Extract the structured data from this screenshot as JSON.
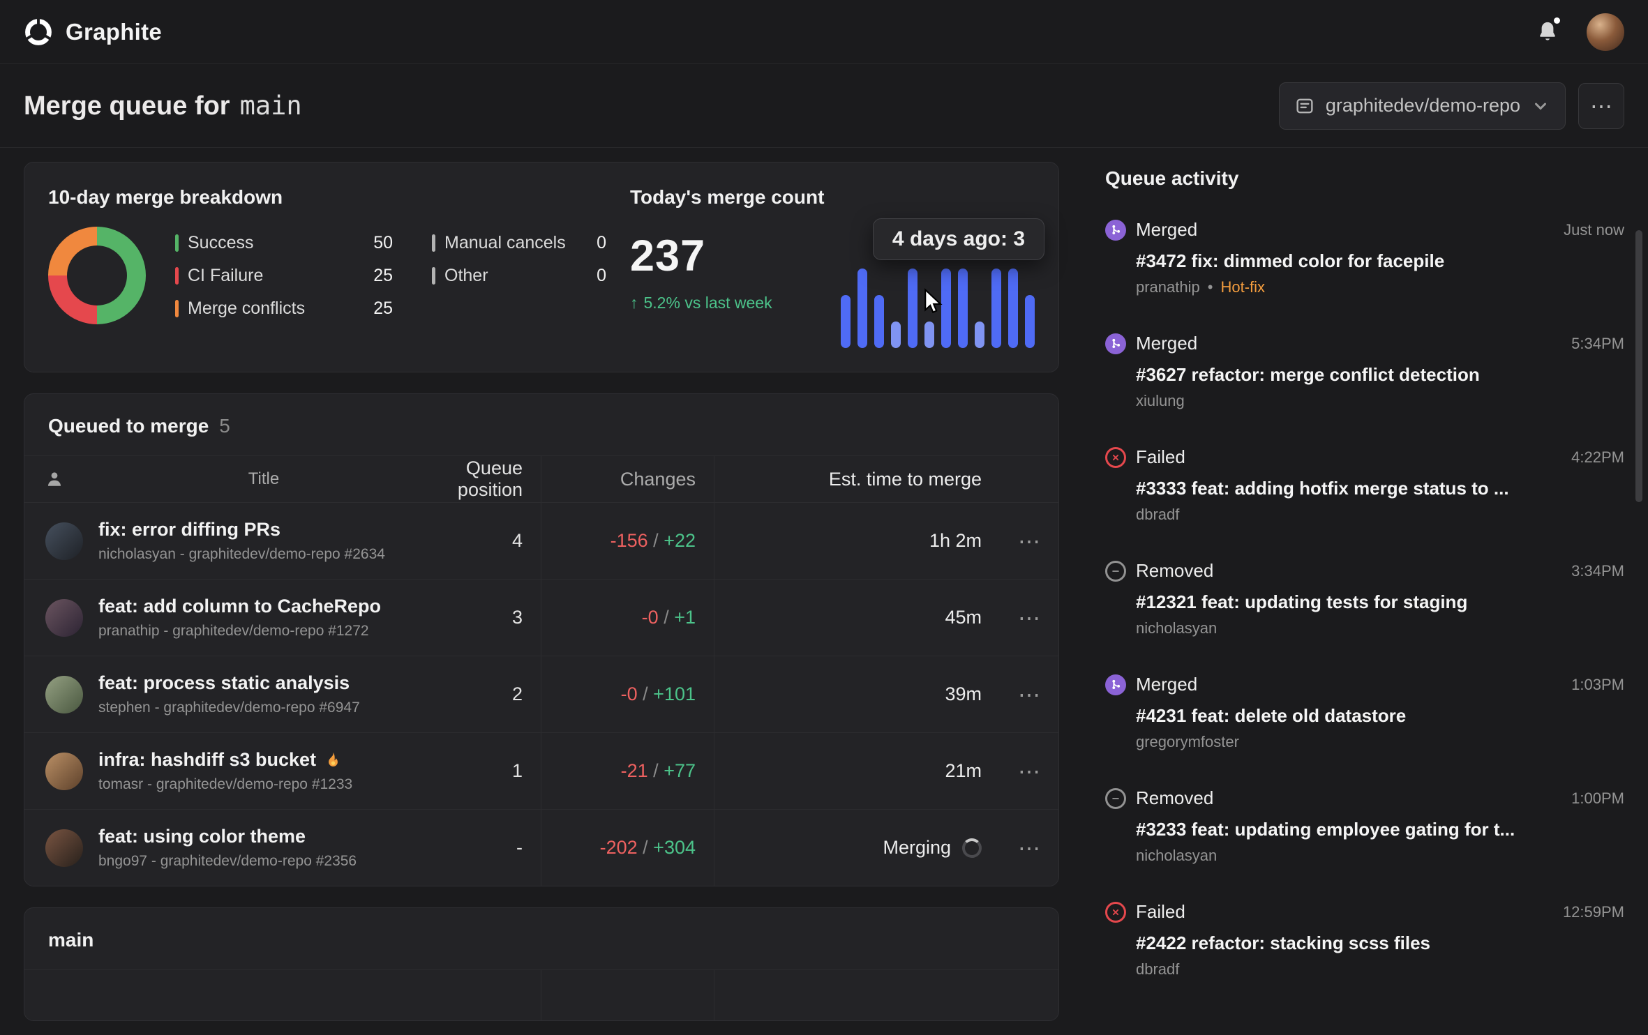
{
  "colors": {
    "bg": "#1b1b1d",
    "card": "#232326",
    "border": "#2e2e32",
    "line": "#2c2c2f",
    "text": "#ececec",
    "muted": "#9b9b9b",
    "green": "#4cc38a",
    "red": "#e5484d",
    "orange": "#f0883e",
    "purple": "#8b63d6",
    "blue": "#4f6bf5",
    "badge_orange": "#f49d3e"
  },
  "topbar": {
    "brand": "Graphite"
  },
  "header": {
    "title_prefix": "Merge queue for",
    "branch": "main",
    "repo_selector": "graphitedev/demo-repo",
    "more_icon": "⋯"
  },
  "breakdown": {
    "title": "10-day merge breakdown",
    "legend": [
      {
        "label": "Success",
        "value": "50",
        "color": "#55b467"
      },
      {
        "label": "CI Failure",
        "value": "25",
        "color": "#e5484d"
      },
      {
        "label": "Merge conflicts",
        "value": "25",
        "color": "#f0883e"
      },
      {
        "label": "Manual cancels",
        "value": "0",
        "color": "#b3b3b3"
      },
      {
        "label": "Other",
        "value": "0",
        "color": "#b3b3b3"
      }
    ]
  },
  "merge_count": {
    "title": "Today's merge count",
    "value": "237",
    "delta_arrow": "↑",
    "delta_text": "5.2% vs last week",
    "tooltip": "4 days ago: 3"
  },
  "chart_data": [
    {
      "type": "pie",
      "donut": true,
      "title": "10-day merge breakdown",
      "labels": [
        "Success",
        "CI Failure",
        "Merge conflicts",
        "Manual cancels",
        "Other"
      ],
      "values": [
        50,
        25,
        25,
        0,
        0
      ],
      "colors": [
        "#55b467",
        "#e5484d",
        "#f0883e",
        "#b3b3b3",
        "#b3b3b3"
      ]
    },
    {
      "type": "bar",
      "title": "Today's merge count",
      "total_today": 237,
      "delta_vs_last_week": "+5.2%",
      "values": [
        2,
        3,
        2,
        1,
        3,
        1,
        3,
        3,
        1,
        3,
        3,
        2
      ],
      "ylim": [
        0,
        3
      ],
      "colors": [
        "#4f6bf5",
        "#4f6bf5",
        "#4f6bf5",
        "#8094f2",
        "#4f6bf5",
        "#8094f2",
        "#4f6bf5",
        "#4f6bf5",
        "#8094f2",
        "#4f6bf5",
        "#4f6bf5",
        "#4f6bf5"
      ],
      "hover": {
        "index": 7,
        "label": "4 days ago: 3"
      }
    }
  ],
  "queued": {
    "title": "Queued to merge",
    "count": "5",
    "changes_separator": " / ",
    "more_icon": "⋯",
    "columns": {
      "title": "Title",
      "position": "Queue position",
      "changes": "Changes",
      "est": "Est. time to merge"
    },
    "rows": [
      {
        "title": "fix: error diffing PRs",
        "author": "nicholasyan - graphitedev/demo-repo #2634",
        "position": "4",
        "minus": "-156",
        "plus": "+22",
        "est": "1h 2m",
        "has_flame": false,
        "merging": false
      },
      {
        "title": "feat: add column to CacheRepo",
        "author": "pranathip - graphitedev/demo-repo #1272",
        "position": "3",
        "minus": "-0",
        "plus": "+1",
        "est": "45m",
        "has_flame": false,
        "merging": false
      },
      {
        "title": "feat: process static analysis",
        "author": "stephen - graphitedev/demo-repo #6947",
        "position": "2",
        "minus": "-0",
        "plus": "+101",
        "est": "39m",
        "has_flame": false,
        "merging": false
      },
      {
        "title": "infra: hashdiff s3 bucket",
        "author": "tomasr - graphitedev/demo-repo #1233",
        "position": "1",
        "minus": "-21",
        "plus": "+77",
        "est": "21m",
        "has_flame": true,
        "merging": false
      },
      {
        "title": "feat: using color theme",
        "author": "bngo97 - graphitedev/demo-repo #2356",
        "position": "-",
        "minus": "-202",
        "plus": "+304",
        "est": "Merging",
        "has_flame": false,
        "merging": true
      }
    ]
  },
  "main_branch": {
    "title": "main"
  },
  "activity": {
    "title": "Queue activity",
    "items": [
      {
        "status": "Merged",
        "time": "Just now",
        "title": "#3472 fix: dimmed color for facepile",
        "author": "pranathip",
        "badge": "Hot-fix"
      },
      {
        "status": "Merged",
        "time": "5:34PM",
        "title": "#3627 refactor: merge conflict detection",
        "author": "xiulung"
      },
      {
        "status": "Failed",
        "time": "4:22PM",
        "title": "#3333 feat: adding hotfix merge status to ...",
        "author": "dbradf"
      },
      {
        "status": "Removed",
        "time": "3:34PM",
        "title": "#12321 feat: updating tests for staging",
        "author": "nicholasyan"
      },
      {
        "status": "Merged",
        "time": "1:03PM",
        "title": "#4231 feat: delete old datastore",
        "author": "gregorymfoster"
      },
      {
        "status": "Removed",
        "time": "1:00PM",
        "title": "#3233 feat: updating employee gating for t...",
        "author": "nicholasyan"
      },
      {
        "status": "Failed",
        "time": "12:59PM",
        "title": "#2422 refactor: stacking scss files",
        "author": "dbradf"
      }
    ]
  }
}
